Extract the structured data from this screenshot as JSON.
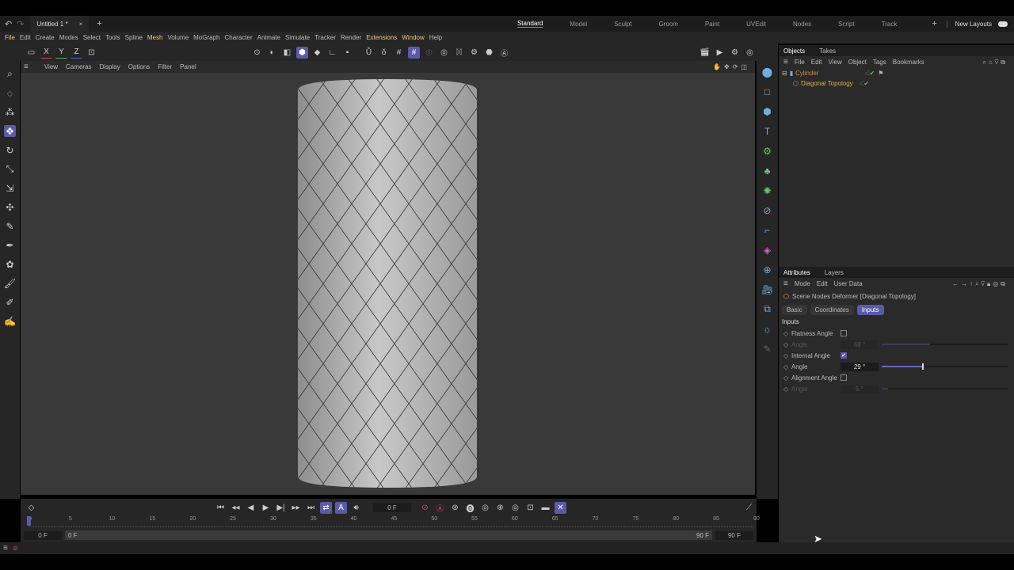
{
  "tabbar": {
    "doc_tab": "Untitled 1 *",
    "layouts": [
      "Standard",
      "Model",
      "Sculpt",
      "Groom",
      "Paint",
      "UVEdit",
      "Nodes",
      "Script",
      "Track"
    ],
    "active_layout": "Standard",
    "new_layouts": "New Layouts"
  },
  "menu": [
    "File",
    "Edit",
    "Create",
    "Modes",
    "Select",
    "Tools",
    "Spline",
    "Mesh",
    "Volume",
    "MoGraph",
    "Character",
    "Animate",
    "Simulate",
    "Tracker",
    "Render",
    "Extensions",
    "Window",
    "Help"
  ],
  "toolbar": {
    "axes": [
      "X",
      "Y",
      "Z"
    ]
  },
  "viewport_menu": [
    "View",
    "Cameras",
    "Display",
    "Options",
    "Filter",
    "Panel"
  ],
  "objects": {
    "tabs": [
      "Objects",
      "Takes"
    ],
    "menu": [
      "File",
      "Edit",
      "View",
      "Object",
      "Tags",
      "Bookmarks"
    ],
    "items": [
      {
        "name": "Cylinder",
        "color": "#d08a40"
      },
      {
        "name": "Diagonal Topology",
        "color": "#e0b040"
      }
    ]
  },
  "attributes": {
    "tabs": [
      "Attributes",
      "Layers"
    ],
    "menu": [
      "Mode",
      "Edit",
      "User Data"
    ],
    "title": "Scene Nodes Deformer [Diagonal Topology]",
    "subtabs": [
      "Basic",
      "Coordinates",
      "Inputs"
    ],
    "active_subtab": "Inputs",
    "section": "Inputs",
    "params": [
      {
        "label": "Flatness Angle",
        "checked": false
      },
      {
        "label": "Angle",
        "value": "68 °",
        "fraction": 0.38,
        "disabled": true
      },
      {
        "label": "Internal Angle",
        "checked": true
      },
      {
        "label": "Angle",
        "value": "29 °",
        "fraction": 0.32,
        "disabled": false
      },
      {
        "label": "Alignment Angle",
        "checked": false
      },
      {
        "label": "Angle",
        "value": "5 °",
        "fraction": 0.05,
        "disabled": true
      }
    ]
  },
  "timeline": {
    "current": "0 F",
    "start": "0 F",
    "range_start": "0 F",
    "range_end": "90 F",
    "end": "90 F",
    "ticks": [
      "0",
      "5",
      "10",
      "15",
      "20",
      "25",
      "30",
      "35",
      "40",
      "45",
      "50",
      "55",
      "60",
      "65",
      "70",
      "75",
      "80",
      "85",
      "90"
    ]
  },
  "colors": {
    "accent": "#5a5aa8",
    "bg": "#262626",
    "viewport": "#393939"
  }
}
